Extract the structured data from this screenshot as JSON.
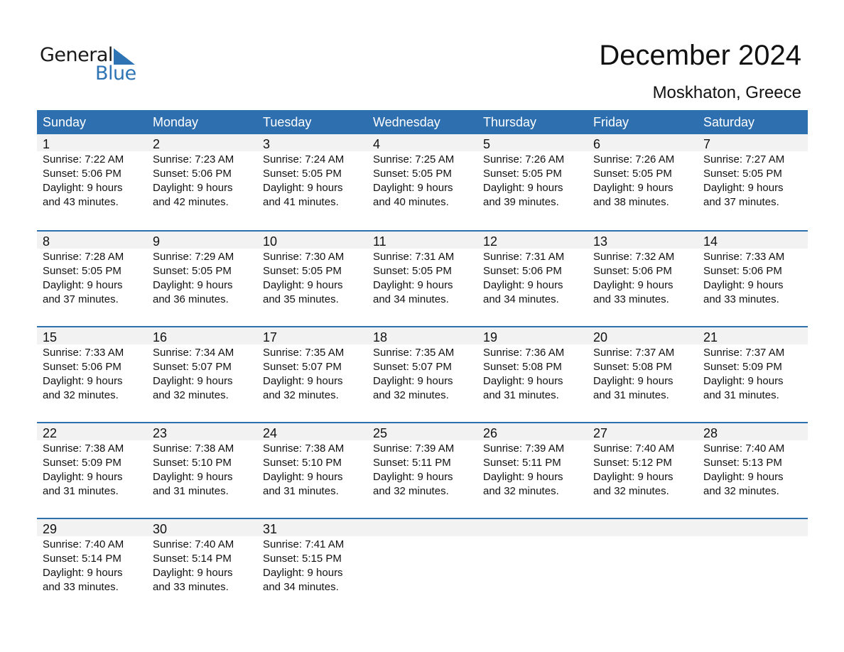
{
  "logo": {
    "text_general": "General",
    "text_blue": "Blue",
    "icon": "triangle-flag-icon",
    "accent": "#2e74b5"
  },
  "title": "December 2024",
  "location": "Moskhaton, Greece",
  "colors": {
    "header_bg": "#2e6fb0",
    "day_band": "#f2f2f2"
  },
  "weekdays": [
    "Sunday",
    "Monday",
    "Tuesday",
    "Wednesday",
    "Thursday",
    "Friday",
    "Saturday"
  ],
  "weeks": [
    [
      {
        "day": "1",
        "sunrise": "Sunrise: 7:22 AM",
        "sunset": "Sunset: 5:06 PM",
        "daylight1": "Daylight: 9 hours",
        "daylight2": "and 43 minutes."
      },
      {
        "day": "2",
        "sunrise": "Sunrise: 7:23 AM",
        "sunset": "Sunset: 5:06 PM",
        "daylight1": "Daylight: 9 hours",
        "daylight2": "and 42 minutes."
      },
      {
        "day": "3",
        "sunrise": "Sunrise: 7:24 AM",
        "sunset": "Sunset: 5:05 PM",
        "daylight1": "Daylight: 9 hours",
        "daylight2": "and 41 minutes."
      },
      {
        "day": "4",
        "sunrise": "Sunrise: 7:25 AM",
        "sunset": "Sunset: 5:05 PM",
        "daylight1": "Daylight: 9 hours",
        "daylight2": "and 40 minutes."
      },
      {
        "day": "5",
        "sunrise": "Sunrise: 7:26 AM",
        "sunset": "Sunset: 5:05 PM",
        "daylight1": "Daylight: 9 hours",
        "daylight2": "and 39 minutes."
      },
      {
        "day": "6",
        "sunrise": "Sunrise: 7:26 AM",
        "sunset": "Sunset: 5:05 PM",
        "daylight1": "Daylight: 9 hours",
        "daylight2": "and 38 minutes."
      },
      {
        "day": "7",
        "sunrise": "Sunrise: 7:27 AM",
        "sunset": "Sunset: 5:05 PM",
        "daylight1": "Daylight: 9 hours",
        "daylight2": "and 37 minutes."
      }
    ],
    [
      {
        "day": "8",
        "sunrise": "Sunrise: 7:28 AM",
        "sunset": "Sunset: 5:05 PM",
        "daylight1": "Daylight: 9 hours",
        "daylight2": "and 37 minutes."
      },
      {
        "day": "9",
        "sunrise": "Sunrise: 7:29 AM",
        "sunset": "Sunset: 5:05 PM",
        "daylight1": "Daylight: 9 hours",
        "daylight2": "and 36 minutes."
      },
      {
        "day": "10",
        "sunrise": "Sunrise: 7:30 AM",
        "sunset": "Sunset: 5:05 PM",
        "daylight1": "Daylight: 9 hours",
        "daylight2": "and 35 minutes."
      },
      {
        "day": "11",
        "sunrise": "Sunrise: 7:31 AM",
        "sunset": "Sunset: 5:05 PM",
        "daylight1": "Daylight: 9 hours",
        "daylight2": "and 34 minutes."
      },
      {
        "day": "12",
        "sunrise": "Sunrise: 7:31 AM",
        "sunset": "Sunset: 5:06 PM",
        "daylight1": "Daylight: 9 hours",
        "daylight2": "and 34 minutes."
      },
      {
        "day": "13",
        "sunrise": "Sunrise: 7:32 AM",
        "sunset": "Sunset: 5:06 PM",
        "daylight1": "Daylight: 9 hours",
        "daylight2": "and 33 minutes."
      },
      {
        "day": "14",
        "sunrise": "Sunrise: 7:33 AM",
        "sunset": "Sunset: 5:06 PM",
        "daylight1": "Daylight: 9 hours",
        "daylight2": "and 33 minutes."
      }
    ],
    [
      {
        "day": "15",
        "sunrise": "Sunrise: 7:33 AM",
        "sunset": "Sunset: 5:06 PM",
        "daylight1": "Daylight: 9 hours",
        "daylight2": "and 32 minutes."
      },
      {
        "day": "16",
        "sunrise": "Sunrise: 7:34 AM",
        "sunset": "Sunset: 5:07 PM",
        "daylight1": "Daylight: 9 hours",
        "daylight2": "and 32 minutes."
      },
      {
        "day": "17",
        "sunrise": "Sunrise: 7:35 AM",
        "sunset": "Sunset: 5:07 PM",
        "daylight1": "Daylight: 9 hours",
        "daylight2": "and 32 minutes."
      },
      {
        "day": "18",
        "sunrise": "Sunrise: 7:35 AM",
        "sunset": "Sunset: 5:07 PM",
        "daylight1": "Daylight: 9 hours",
        "daylight2": "and 32 minutes."
      },
      {
        "day": "19",
        "sunrise": "Sunrise: 7:36 AM",
        "sunset": "Sunset: 5:08 PM",
        "daylight1": "Daylight: 9 hours",
        "daylight2": "and 31 minutes."
      },
      {
        "day": "20",
        "sunrise": "Sunrise: 7:37 AM",
        "sunset": "Sunset: 5:08 PM",
        "daylight1": "Daylight: 9 hours",
        "daylight2": "and 31 minutes."
      },
      {
        "day": "21",
        "sunrise": "Sunrise: 7:37 AM",
        "sunset": "Sunset: 5:09 PM",
        "daylight1": "Daylight: 9 hours",
        "daylight2": "and 31 minutes."
      }
    ],
    [
      {
        "day": "22",
        "sunrise": "Sunrise: 7:38 AM",
        "sunset": "Sunset: 5:09 PM",
        "daylight1": "Daylight: 9 hours",
        "daylight2": "and 31 minutes."
      },
      {
        "day": "23",
        "sunrise": "Sunrise: 7:38 AM",
        "sunset": "Sunset: 5:10 PM",
        "daylight1": "Daylight: 9 hours",
        "daylight2": "and 31 minutes."
      },
      {
        "day": "24",
        "sunrise": "Sunrise: 7:38 AM",
        "sunset": "Sunset: 5:10 PM",
        "daylight1": "Daylight: 9 hours",
        "daylight2": "and 31 minutes."
      },
      {
        "day": "25",
        "sunrise": "Sunrise: 7:39 AM",
        "sunset": "Sunset: 5:11 PM",
        "daylight1": "Daylight: 9 hours",
        "daylight2": "and 32 minutes."
      },
      {
        "day": "26",
        "sunrise": "Sunrise: 7:39 AM",
        "sunset": "Sunset: 5:11 PM",
        "daylight1": "Daylight: 9 hours",
        "daylight2": "and 32 minutes."
      },
      {
        "day": "27",
        "sunrise": "Sunrise: 7:40 AM",
        "sunset": "Sunset: 5:12 PM",
        "daylight1": "Daylight: 9 hours",
        "daylight2": "and 32 minutes."
      },
      {
        "day": "28",
        "sunrise": "Sunrise: 7:40 AM",
        "sunset": "Sunset: 5:13 PM",
        "daylight1": "Daylight: 9 hours",
        "daylight2": "and 32 minutes."
      }
    ],
    [
      {
        "day": "29",
        "sunrise": "Sunrise: 7:40 AM",
        "sunset": "Sunset: 5:14 PM",
        "daylight1": "Daylight: 9 hours",
        "daylight2": "and 33 minutes."
      },
      {
        "day": "30",
        "sunrise": "Sunrise: 7:40 AM",
        "sunset": "Sunset: 5:14 PM",
        "daylight1": "Daylight: 9 hours",
        "daylight2": "and 33 minutes."
      },
      {
        "day": "31",
        "sunrise": "Sunrise: 7:41 AM",
        "sunset": "Sunset: 5:15 PM",
        "daylight1": "Daylight: 9 hours",
        "daylight2": "and 34 minutes."
      },
      null,
      null,
      null,
      null
    ]
  ]
}
